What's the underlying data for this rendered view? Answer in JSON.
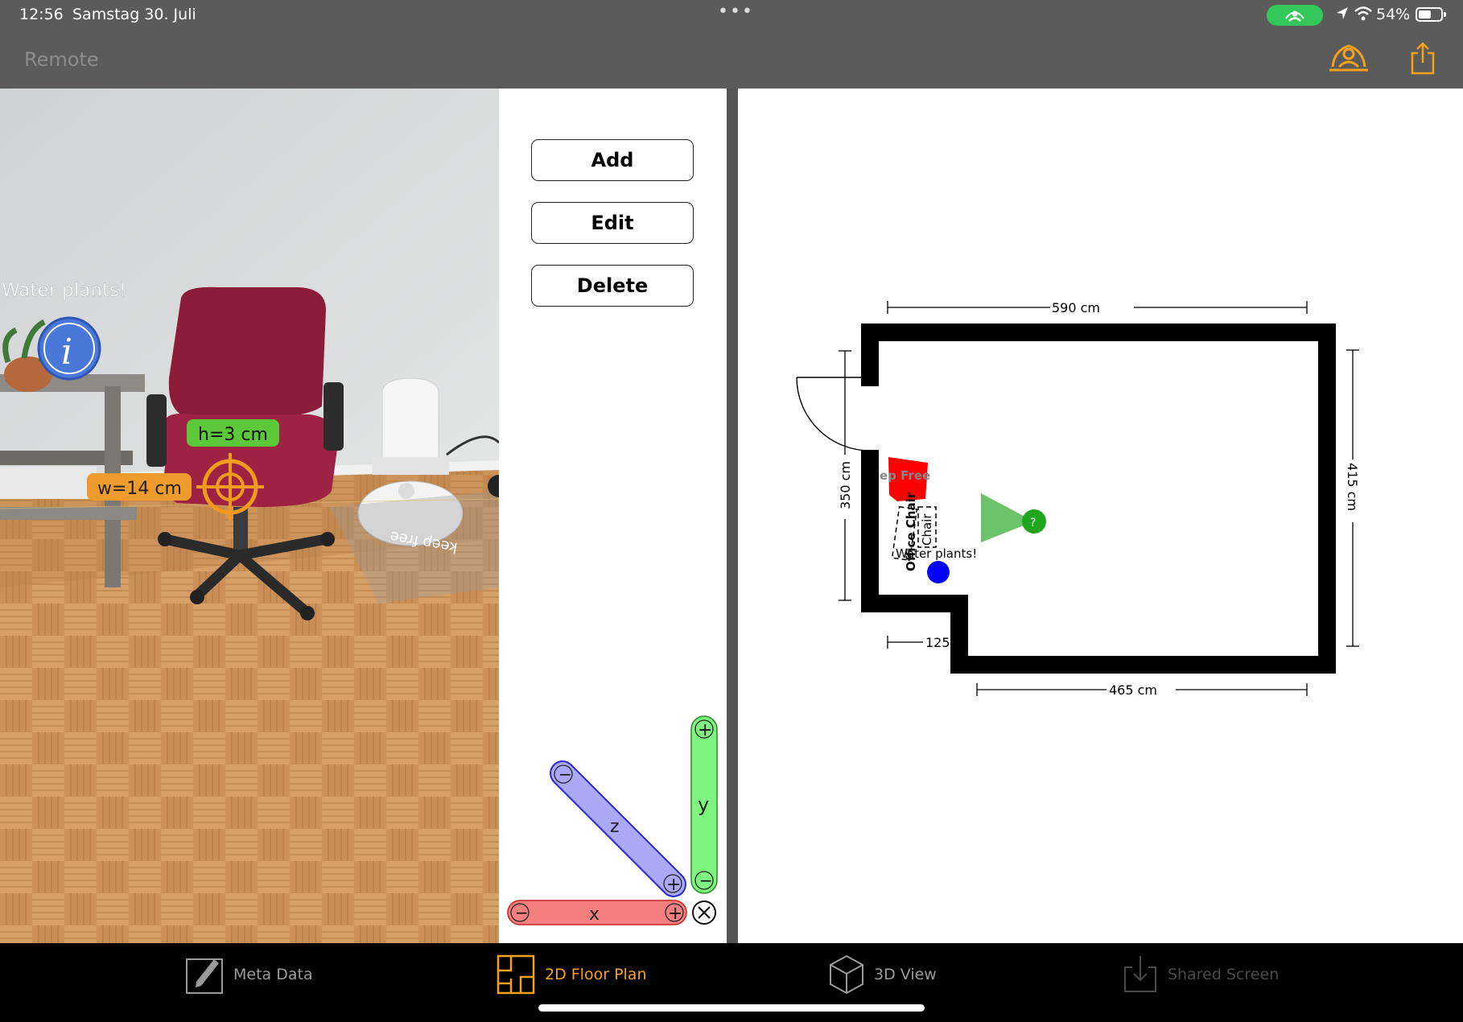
{
  "status_bar": {
    "time": "12:56",
    "date": "Samstag 30. Juli",
    "dots": "•••",
    "battery": "54%"
  },
  "nav": {
    "title": "Remote"
  },
  "ar_view": {
    "note_label": "Water plants!",
    "height_label": "h=3 cm",
    "width_label": "w=14 cm",
    "floor_label": "keep free"
  },
  "buttons": {
    "add": "Add",
    "edit": "Edit",
    "delete": "Delete"
  },
  "axis_gizmo": {
    "z_label": "z",
    "y_label": "y",
    "x_label": "x",
    "plus": "+",
    "minus": "−",
    "close_symbol": "⊗"
  },
  "floor_plan": {
    "dim_top": "590 cm",
    "dim_right": "415 cm",
    "dim_left": "350 cm",
    "dim_bottom_right": "465 cm",
    "dim_bottom_left": "125 c",
    "zone_label": "ep Free",
    "office_chair_label": "Office Chair",
    "chair_label": "Chair",
    "note_label": "Water plants!",
    "camera_marker": "?"
  },
  "tabs": [
    {
      "label": "Meta Data",
      "icon": "edit-document-icon",
      "state": "normal"
    },
    {
      "label": "2D Floor Plan",
      "icon": "floor-plan-icon",
      "state": "active"
    },
    {
      "label": "3D View",
      "icon": "cube-icon",
      "state": "normal"
    },
    {
      "label": "Shared Screen",
      "icon": "download-tray-icon",
      "state": "disabled"
    }
  ],
  "colors": {
    "accent": "#f7a21b",
    "bar_bg": "#5b5b5b",
    "x_axis": "#f47f7f",
    "y_axis": "#7ef57e",
    "z_axis": "#a9a9f7",
    "keep_free_zone": "#ff0000",
    "note_marker": "#0000ff",
    "camera_marker": "#22aa22"
  }
}
